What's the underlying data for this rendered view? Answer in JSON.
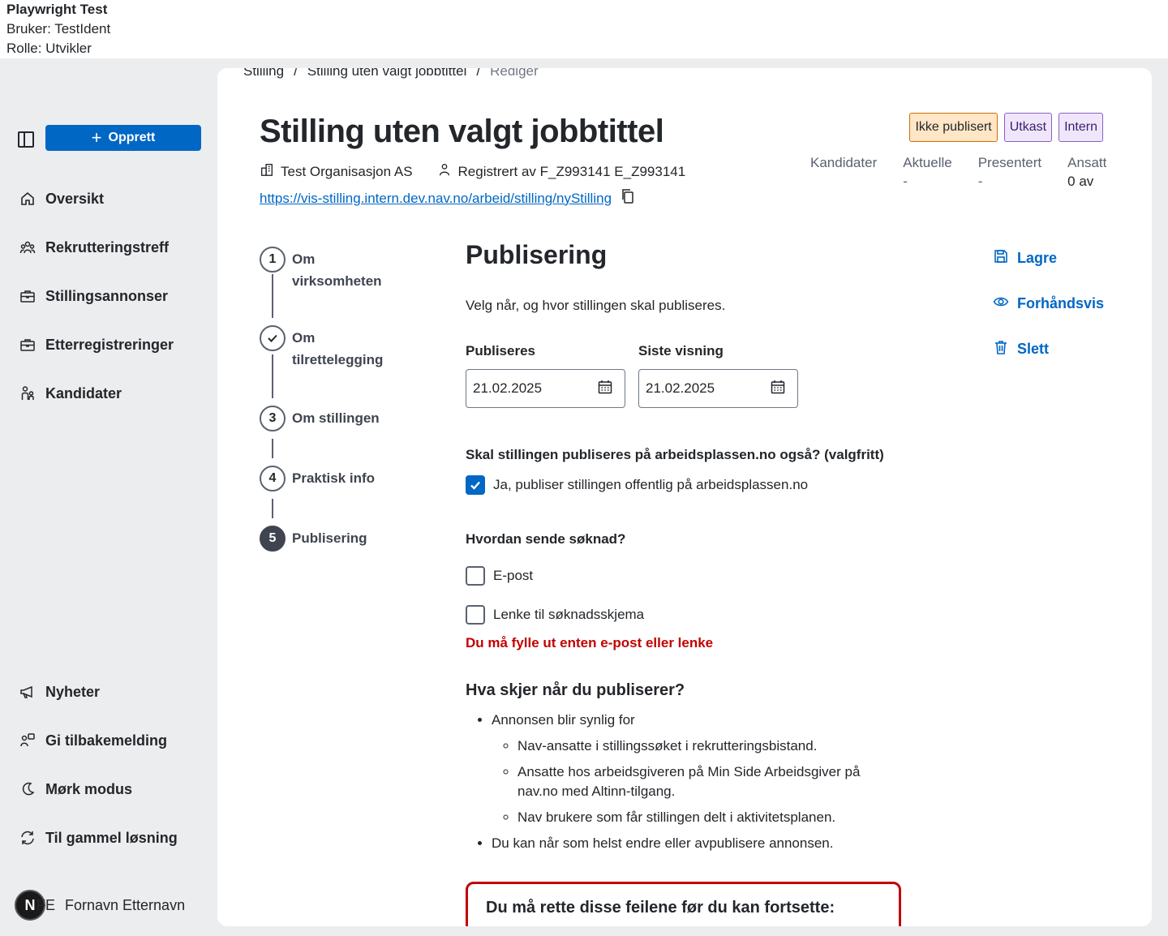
{
  "banner": {
    "title": "Playwright Test",
    "user": "Bruker: TestIdent",
    "role": "Rolle: Utvikler"
  },
  "sidebar": {
    "create_label": "Opprett",
    "items": [
      {
        "label": "Oversikt",
        "icon": "house-icon"
      },
      {
        "label": "Rekrutteringstreff",
        "icon": "people-icon"
      },
      {
        "label": "Stillingsannonser",
        "icon": "briefcase-icon"
      },
      {
        "label": "Etterregistreringer",
        "icon": "briefcase-icon"
      },
      {
        "label": "Kandidater",
        "icon": "person-group-icon"
      }
    ],
    "bottom_items": [
      {
        "label": "Nyheter",
        "icon": "megaphone-icon"
      },
      {
        "label": "Gi tilbakemelding",
        "icon": "feedback-icon"
      },
      {
        "label": "Mørk modus",
        "icon": "moon-icon"
      },
      {
        "label": "Til gammel løsning",
        "icon": "arrows-circle-icon"
      }
    ],
    "user": {
      "avatar_letter": "N",
      "initials": "FE",
      "name": "Fornavn Etternavn"
    }
  },
  "breadcrumb": {
    "items": [
      "Stilling",
      "/",
      "Stilling uten valgt jobbtittel",
      "/",
      "Rediger"
    ]
  },
  "header": {
    "title": "Stilling uten valgt jobbtittel",
    "organization": "Test Organisasjon AS",
    "registered_by": "Registrert av F_Z993141 E_Z993141",
    "url": "https://vis-stilling.intern.dev.nav.no/arbeid/stilling/nyStilling",
    "tags": [
      "Ikke publisert",
      "Utkast",
      "Intern"
    ]
  },
  "stats": [
    {
      "label": "Kandidater",
      "value": ""
    },
    {
      "label": "Aktuelle",
      "value": "-"
    },
    {
      "label": "Presentert",
      "value": "-"
    },
    {
      "label": "Ansatt",
      "value": "0 av"
    }
  ],
  "stepper": [
    {
      "number": "1",
      "label_line1": "Om",
      "label_line2": "virksomheten",
      "state": "default"
    },
    {
      "number": "✓",
      "label_line1": "Om",
      "label_line2": "tilrettelegging",
      "state": "completed"
    },
    {
      "number": "3",
      "label_line1": "Om stillingen",
      "label_line2": "",
      "state": "default"
    },
    {
      "number": "4",
      "label_line1": "Praktisk info",
      "label_line2": "",
      "state": "default"
    },
    {
      "number": "5",
      "label_line1": "Publisering",
      "label_line2": "",
      "state": "active"
    }
  ],
  "form": {
    "heading": "Publisering",
    "intro": "Velg når, og hvor stillingen skal publiseres.",
    "publish_label": "Publiseres",
    "publish_value": "21.02.2025",
    "last_label": "Siste visning",
    "last_value": "21.02.2025",
    "question1": "Skal stillingen publiseres på arbeidsplassen.no også? (valgfritt)",
    "checkbox_public": "Ja, publiser stillingen offentlig på arbeidsplassen.no",
    "question2": "Hvordan sende søknad?",
    "checkbox_email": "E-post",
    "checkbox_link": "Lenke til søknadsskjema",
    "error_text": "Du må fylle ut enten e-post eller lenke",
    "what_heading": "Hva skjer når du publiserer?",
    "bullet1": "Annonsen blir synlig for",
    "sub1": "Nav-ansatte i stillingssøket i rekrutteringsbistand.",
    "sub2": "Ansatte hos arbeidsgiveren på Min Side Arbeidsgiver på nav.no med Altinn-tilgang.",
    "sub3": "Nav brukere som får stillingen delt i aktivitetsplanen.",
    "bullet2": "Du kan når som helst endre eller avpublisere annonsen.",
    "errorbox_title": "Du må rette disse feilene før du kan fortsette:"
  },
  "actions": {
    "save": "Lagre",
    "preview": "Forhåndsvis",
    "delete": "Slett"
  },
  "colors": {
    "accent": "#0067c5",
    "error": "#c30000",
    "background": "#ecedef"
  }
}
